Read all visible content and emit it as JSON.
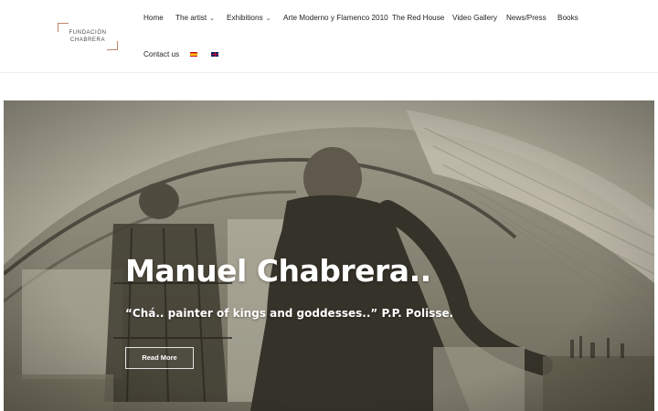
{
  "logo": {
    "line1": "FUNDACIÓN",
    "line2": "CHABRERA",
    "accent": "#c0846b"
  },
  "nav": {
    "items": [
      {
        "label": "Home"
      },
      {
        "label": "The artist",
        "dropdown": true
      },
      {
        "label": "Exhibitions",
        "dropdown": true
      },
      {
        "label": "Arte Moderno y Flamenco 2010"
      },
      {
        "label": "The Red House"
      },
      {
        "label": "Video Gallery"
      },
      {
        "label": "News/Press"
      },
      {
        "label": "Books"
      }
    ],
    "contact": "Contact us",
    "flags": [
      "spanish-flag-icon",
      "uk-flag-icon"
    ]
  },
  "hero": {
    "title": "Manuel Chabrera..",
    "quote": "“Chá.. painter of kings and goddesses..” P.P. Polisse.",
    "button": "Read More"
  }
}
